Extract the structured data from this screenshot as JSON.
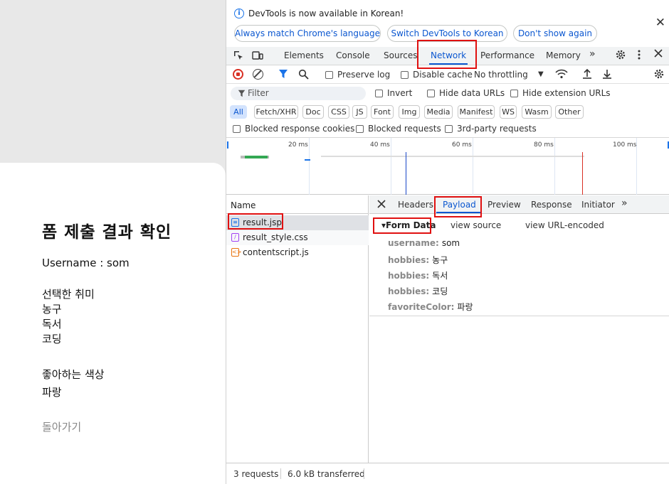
{
  "page": {
    "title": "폼 제출 결과 확인",
    "username_line": "Username : som",
    "hobbies_heading": "선택한 취미",
    "hobbies": [
      "농구",
      "독서",
      "코딩"
    ],
    "color_heading": "좋아하는 색상",
    "color_value": "파랑",
    "back_link": "돌아가기"
  },
  "devtools": {
    "infobar": {
      "message": "DevTools is now available in Korean!",
      "buttons": [
        "Always match Chrome's language",
        "Switch DevTools to Korean",
        "Don't show again"
      ],
      "close": "✕"
    },
    "tabs": [
      "Elements",
      "Console",
      "Sources",
      "Network",
      "Performance",
      "Memory"
    ],
    "active_tab": "Network",
    "more_tabs": "»",
    "toolbar": {
      "preserve_log": "Preserve log",
      "disable_cache": "Disable cache",
      "throttling": "No throttling"
    },
    "filter": {
      "placeholder": "Filter",
      "invert": "Invert",
      "hide_data_urls": "Hide data URLs",
      "hide_extension_urls": "Hide extension URLs"
    },
    "type_filters": [
      "All",
      "Fetch/XHR",
      "Doc",
      "CSS",
      "JS",
      "Font",
      "Img",
      "Media",
      "Manifest",
      "WS",
      "Wasm",
      "Other"
    ],
    "extra_filters": [
      "Blocked response cookies",
      "Blocked requests",
      "3rd-party requests"
    ],
    "timeline_ticks": [
      "20 ms",
      "40 ms",
      "60 ms",
      "80 ms",
      "100 ms"
    ],
    "requests": {
      "column": "Name",
      "rows": [
        {
          "name": "result.jsp",
          "icon": "document-icon",
          "selected": true
        },
        {
          "name": "result_style.css",
          "icon": "css-icon"
        },
        {
          "name": "contentscript.js",
          "icon": "script-icon"
        }
      ]
    },
    "detail_tabs": [
      "Headers",
      "Payload",
      "Preview",
      "Response",
      "Initiator"
    ],
    "active_detail_tab": "Payload",
    "payload": {
      "section": "▾Form Data",
      "view_source": "view source",
      "view_url_encoded": "view URL-encoded",
      "fields": [
        {
          "key": "username:",
          "value": "som"
        },
        {
          "key": "hobbies:",
          "value": "농구"
        },
        {
          "key": "hobbies:",
          "value": "독서"
        },
        {
          "key": "hobbies:",
          "value": "코딩"
        },
        {
          "key": "favoriteColor:",
          "value": "파랑"
        }
      ]
    },
    "status": {
      "requests": "3 requests",
      "transferred": "6.0 kB transferred"
    },
    "colors": {
      "accent": "#0b57d0",
      "highlight_box": "#e01010",
      "record": "#d93025"
    }
  }
}
